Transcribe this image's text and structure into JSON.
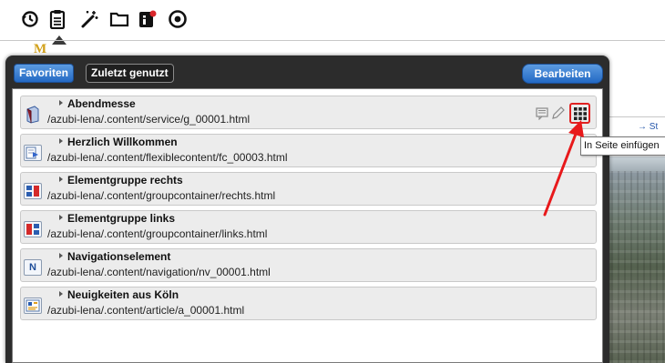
{
  "toolbar": {
    "icons": [
      "history-icon",
      "clipboard-icon",
      "magic-wand-icon",
      "folder-icon",
      "info-icon",
      "target-icon"
    ]
  },
  "background": {
    "link_text": "→ St"
  },
  "panel": {
    "tabs": {
      "favorites": "Favoriten",
      "recent": "Zuletzt genutzt"
    },
    "edit_button": "Bearbeiten",
    "items": [
      {
        "title": "Abendmesse",
        "path": "/azubi-lena/.content/service/g_00001.html",
        "icon": "ghost-page-icon"
      },
      {
        "title": "Herzlich Willkommen",
        "path": "/azubi-lena/.content/flexiblecontent/fc_00003.html",
        "icon": "flexible-content-icon"
      },
      {
        "title": "Elementgruppe rechts",
        "path": "/azubi-lena/.content/groupcontainer/rechts.html",
        "icon": "group-container-icon"
      },
      {
        "title": "Elementgruppe links",
        "path": "/azubi-lena/.content/groupcontainer/links.html",
        "icon": "group-container-icon"
      },
      {
        "title": "Navigationselement",
        "path": "/azubi-lena/.content/navigation/nv_00001.html",
        "icon": "navigation-icon"
      },
      {
        "title": "Neuigkeiten aus Köln",
        "path": "/azubi-lena/.content/article/a_00001.html",
        "icon": "article-icon"
      }
    ]
  },
  "tooltip": {
    "text": "In Seite einfügen"
  },
  "colors": {
    "accent": "#2369c4",
    "highlight": "#e02020",
    "panel": "#2c2c2c"
  }
}
